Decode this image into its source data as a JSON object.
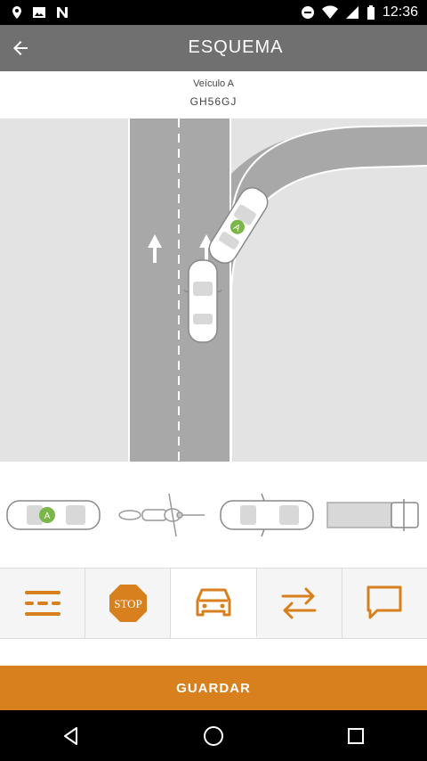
{
  "status_bar": {
    "time": "12:36",
    "icons": [
      "location-icon",
      "image-icon",
      "notification-icon",
      "dnd-icon",
      "wifi-icon",
      "signal-icon",
      "battery-icon"
    ]
  },
  "app_bar": {
    "title": "ESQUEMA",
    "back_icon": "arrow-back-icon"
  },
  "vehicle": {
    "label": "Veículo A",
    "plate": "GH56GJ"
  },
  "scene": {
    "vehicle_badge": "A"
  },
  "palette": {
    "items": [
      {
        "name": "car",
        "badge": "A"
      },
      {
        "name": "motorcycle"
      },
      {
        "name": "car"
      },
      {
        "name": "truck"
      }
    ]
  },
  "toolbar": {
    "items": [
      "lanes-icon",
      "stop-sign-icon",
      "car-icon",
      "swap-arrows-icon",
      "comment-icon"
    ],
    "stop_label": "STOP",
    "active_index": 2
  },
  "actions": {
    "save_label": "GUARDAR"
  },
  "colors": {
    "accent": "#d9801e",
    "app_bar": "#707070",
    "road": "#a8a8a8",
    "badge": "#7ab648"
  }
}
